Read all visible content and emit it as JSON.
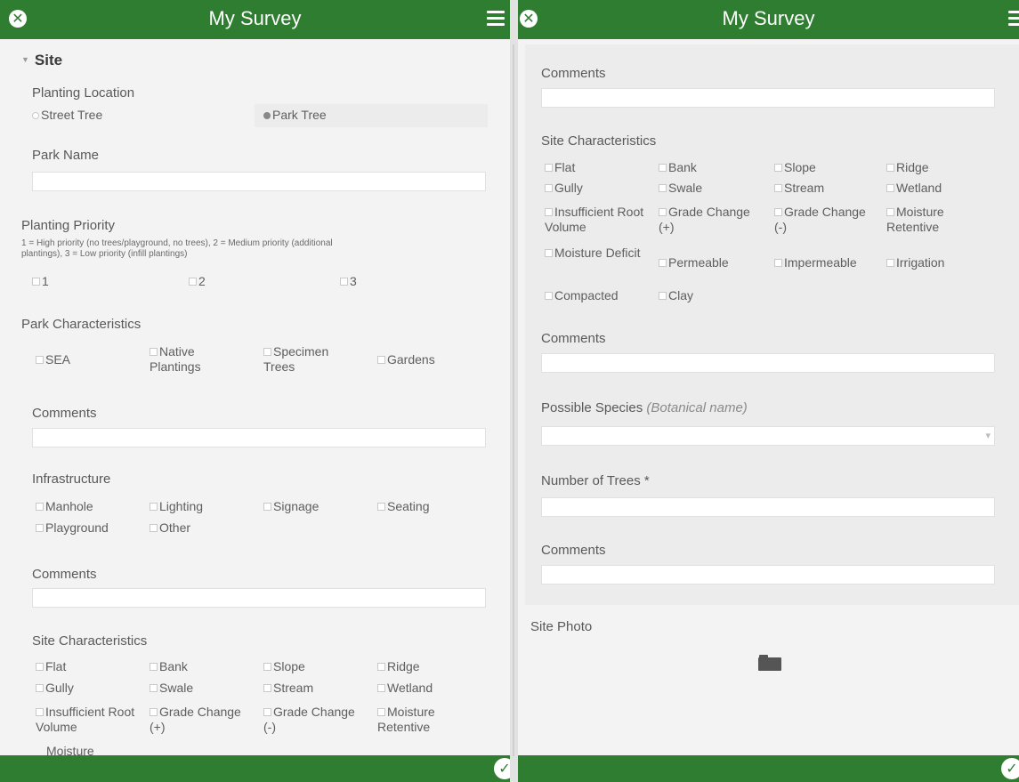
{
  "header": {
    "title": "My Survey"
  },
  "left": {
    "site_heading": "Site",
    "planting_location": {
      "label": "Planting Location",
      "options": [
        "Street Tree",
        "Park Tree"
      ],
      "selected": "Park Tree"
    },
    "park_name": {
      "label": "Park Name",
      "value": ""
    },
    "planting_priority": {
      "label": "Planting Priority",
      "hint_line1": "1 = High priority (no trees/playground, no trees), 2 = Medium priority (additional",
      "hint_line2": "plantings), 3 = Low priority (infill plantings)",
      "options": [
        "1",
        "2",
        "3"
      ]
    },
    "park_characteristics": {
      "label": "Park Characteristics",
      "options": [
        "SEA",
        "Native Plantings",
        "Specimen Trees",
        "Gardens"
      ]
    },
    "comments1": {
      "label": "Comments",
      "value": ""
    },
    "infrastructure": {
      "label": "Infrastructure",
      "options": [
        "Manhole",
        "Lighting",
        "Signage",
        "Seating",
        "Playground",
        "Other"
      ]
    },
    "comments2": {
      "label": "Comments",
      "value": ""
    },
    "site_characteristics": {
      "label": "Site Characteristics",
      "options": [
        "Flat",
        "Bank",
        "Slope",
        "Ridge",
        "Gully",
        "Swale",
        "Stream",
        "Wetland",
        "Insufficient Root Volume",
        "Grade Change (+)",
        "Grade Change (-)",
        "Moisture Retentive",
        "Moisture"
      ]
    }
  },
  "right": {
    "comments_top": {
      "label": "Comments",
      "value": ""
    },
    "site_characteristics": {
      "label": "Site Characteristics",
      "options": [
        "Flat",
        "Bank",
        "Slope",
        "Ridge",
        "Gully",
        "Swale",
        "Stream",
        "Wetland",
        "Insufficient Root Volume",
        "Grade Change (+)",
        "Grade Change (-)",
        "Moisture Retentive",
        "Moisture Deficit",
        "Permeable",
        "Impermeable",
        "Irrigation",
        "Compacted",
        "Clay"
      ]
    },
    "comments_mid": {
      "label": "Comments",
      "value": ""
    },
    "possible_species": {
      "label": "Possible Species",
      "hint": "(Botanical name)",
      "value": ""
    },
    "number_of_trees": {
      "label": "Number of Trees *",
      "value": ""
    },
    "comments_bottom": {
      "label": "Comments",
      "value": ""
    },
    "site_photo": {
      "label": "Site Photo"
    }
  },
  "icons": {
    "close": "close-icon",
    "menu": "menu-icon",
    "submit": "checkmark-icon",
    "folder": "folder-icon",
    "collapse": "triangle-down-icon"
  },
  "colors": {
    "header": "#2f7d31",
    "background": "#f3f3f3"
  }
}
